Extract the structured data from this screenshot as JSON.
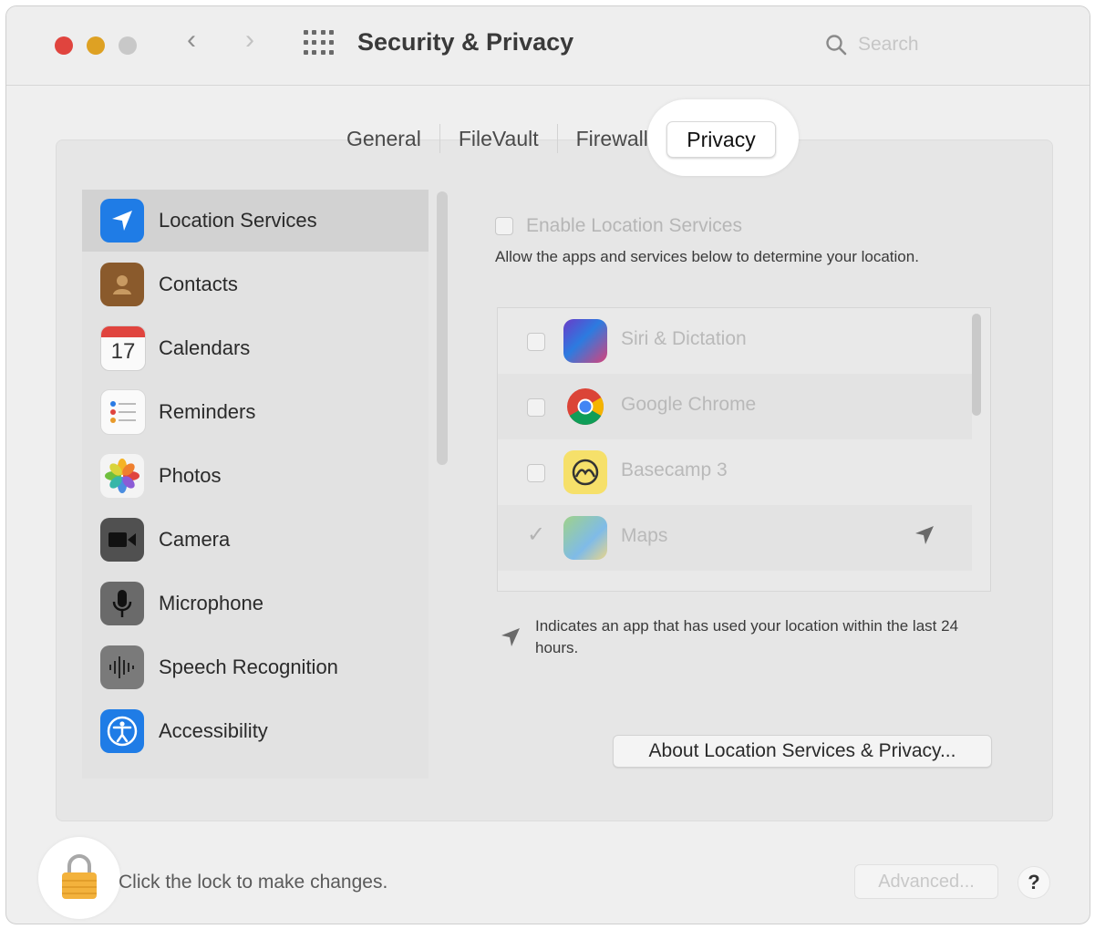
{
  "window": {
    "title": "Security & Privacy",
    "search_placeholder": "Search",
    "nav_back": "‹",
    "nav_forward": "›",
    "traffic_lights": [
      "#e0443e",
      "#dea123",
      "#c8c8c8"
    ]
  },
  "tabs": [
    {
      "label": "General"
    },
    {
      "label": "FileVault"
    },
    {
      "label": "Firewall"
    },
    {
      "label": "Privacy",
      "selected": true
    }
  ],
  "sidebar": {
    "items": [
      {
        "label": "Location Services",
        "icon": "location-arrow-icon",
        "selected": true
      },
      {
        "label": "Contacts",
        "icon": "contacts-book-icon"
      },
      {
        "label": "Calendars",
        "icon": "calendar-icon",
        "icon_text": "17"
      },
      {
        "label": "Reminders",
        "icon": "reminders-list-icon"
      },
      {
        "label": "Photos",
        "icon": "photos-flower-icon"
      },
      {
        "label": "Camera",
        "icon": "video-camera-icon"
      },
      {
        "label": "Microphone",
        "icon": "microphone-icon"
      },
      {
        "label": "Speech Recognition",
        "icon": "waveform-icon"
      },
      {
        "label": "Accessibility",
        "icon": "accessibility-person-icon"
      }
    ]
  },
  "location": {
    "enable_label": "Enable Location Services",
    "description": "Allow the apps and services below to determine your location.",
    "apps": [
      {
        "name": "Siri & Dictation",
        "icon": "siri-icon",
        "checked": false
      },
      {
        "name": "Google Chrome",
        "icon": "chrome-icon",
        "checked": false
      },
      {
        "name": "Basecamp 3",
        "icon": "basecamp-icon",
        "checked": false
      },
      {
        "name": "Maps",
        "icon": "maps-icon",
        "checked": true,
        "recent": true
      }
    ],
    "note": "Indicates an app that has used your location within the last 24 hours.",
    "about_button": "About Location Services & Privacy..."
  },
  "footer": {
    "lock_text": "Click the lock to make changes.",
    "advanced_button": "Advanced...",
    "help_button": "?"
  }
}
